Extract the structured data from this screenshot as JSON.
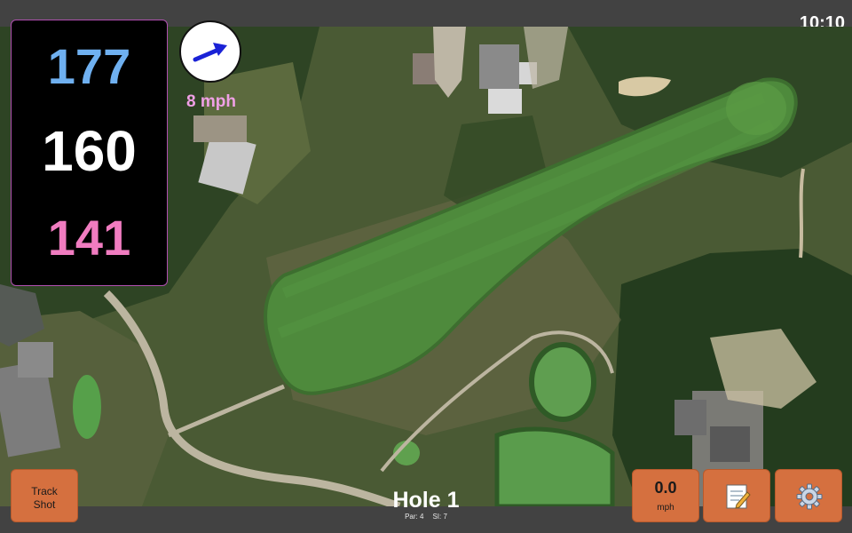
{
  "status_bar": {
    "time": "10:10"
  },
  "distances": {
    "back": "177",
    "middle": "160",
    "front": "141"
  },
  "wind": {
    "speed_label": "8 mph",
    "direction": "blowing-up-right"
  },
  "buttons": {
    "track_shot_line1": "Track",
    "track_shot_line2": "Shot",
    "shot_speed_value": "0.0",
    "shot_speed_unit": "mph",
    "notes_icon": "notepad-icon",
    "settings_icon": "gear-icon"
  },
  "hole": {
    "title": "Hole 1",
    "par_label": "Par: 4",
    "si_label": "SI: 7"
  },
  "colors": {
    "back_distance": "#6fb0f0",
    "middle_distance": "#ffffff",
    "front_distance": "#f07cc0",
    "wind_label": "#f0a0e6",
    "button_orange": "#d5703f",
    "fairway_green": "#4e8a3c"
  }
}
